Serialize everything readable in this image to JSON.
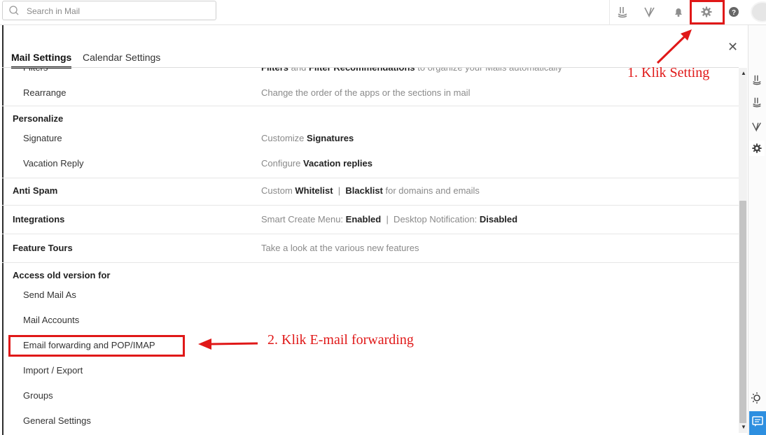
{
  "search": {
    "placeholder": "Search in Mail"
  },
  "top_icons": [
    "zia-icon",
    "vani-icon",
    "bell-icon",
    "gear-icon",
    "help-icon"
  ],
  "settings": {
    "tabs": [
      "Mail Settings",
      "Calendar Settings"
    ],
    "rows": [
      {
        "kind": "sub",
        "label": "Filters",
        "desc": [
          {
            "t": "Filters",
            "b": true
          },
          {
            "t": " and "
          },
          {
            "t": "Filter Recommendations",
            "b": true
          },
          {
            "t": " to organize your Mails automatically"
          }
        ]
      },
      {
        "kind": "sub",
        "label": "Rearrange",
        "desc": [
          {
            "t": "Change the order of the apps or the sections in mail"
          }
        ]
      },
      {
        "kind": "head",
        "label": "Personalize",
        "desc": []
      },
      {
        "kind": "sub",
        "label": "Signature",
        "desc": [
          {
            "t": "Customize "
          },
          {
            "t": "Signatures",
            "b": true
          }
        ]
      },
      {
        "kind": "sub",
        "label": "Vacation Reply",
        "desc": [
          {
            "t": "Configure "
          },
          {
            "t": "Vacation replies",
            "b": true
          }
        ]
      },
      {
        "kind": "head",
        "label": "Anti Spam",
        "desc": [
          {
            "t": "Custom "
          },
          {
            "t": "Whitelist",
            "b": true
          },
          {
            "t": "  |  "
          },
          {
            "t": "Blacklist",
            "b": true
          },
          {
            "t": " for domains and emails"
          }
        ]
      },
      {
        "kind": "head",
        "label": "Integrations",
        "desc": [
          {
            "t": "Smart Create Menu: "
          },
          {
            "t": "Enabled",
            "b": true
          },
          {
            "t": "  |  Desktop Notification: "
          },
          {
            "t": "Disabled",
            "b": true
          }
        ]
      },
      {
        "kind": "head",
        "label": "Feature Tours",
        "desc": [
          {
            "t": "Take a look at the various new features"
          }
        ]
      },
      {
        "kind": "head",
        "label": "Access old version for",
        "desc": []
      },
      {
        "kind": "sub",
        "label": "Send Mail As",
        "desc": []
      },
      {
        "kind": "sub",
        "label": "Mail Accounts",
        "desc": []
      },
      {
        "kind": "sub",
        "label": "Email forwarding and POP/IMAP",
        "desc": []
      },
      {
        "kind": "sub",
        "label": "Import / Export",
        "desc": []
      },
      {
        "kind": "sub",
        "label": "Groups",
        "desc": []
      },
      {
        "kind": "sub",
        "label": "General Settings",
        "desc": []
      }
    ]
  },
  "annotations": {
    "step1": "1. Klik Setting",
    "step2": "2. Klik E-mail forwarding",
    "color": "#e01818"
  },
  "rail_icons": [
    "zia-icon",
    "zia-alt-icon",
    "vani-icon",
    "gear-icon",
    "theme-toggle-icon",
    "chat-icon"
  ]
}
